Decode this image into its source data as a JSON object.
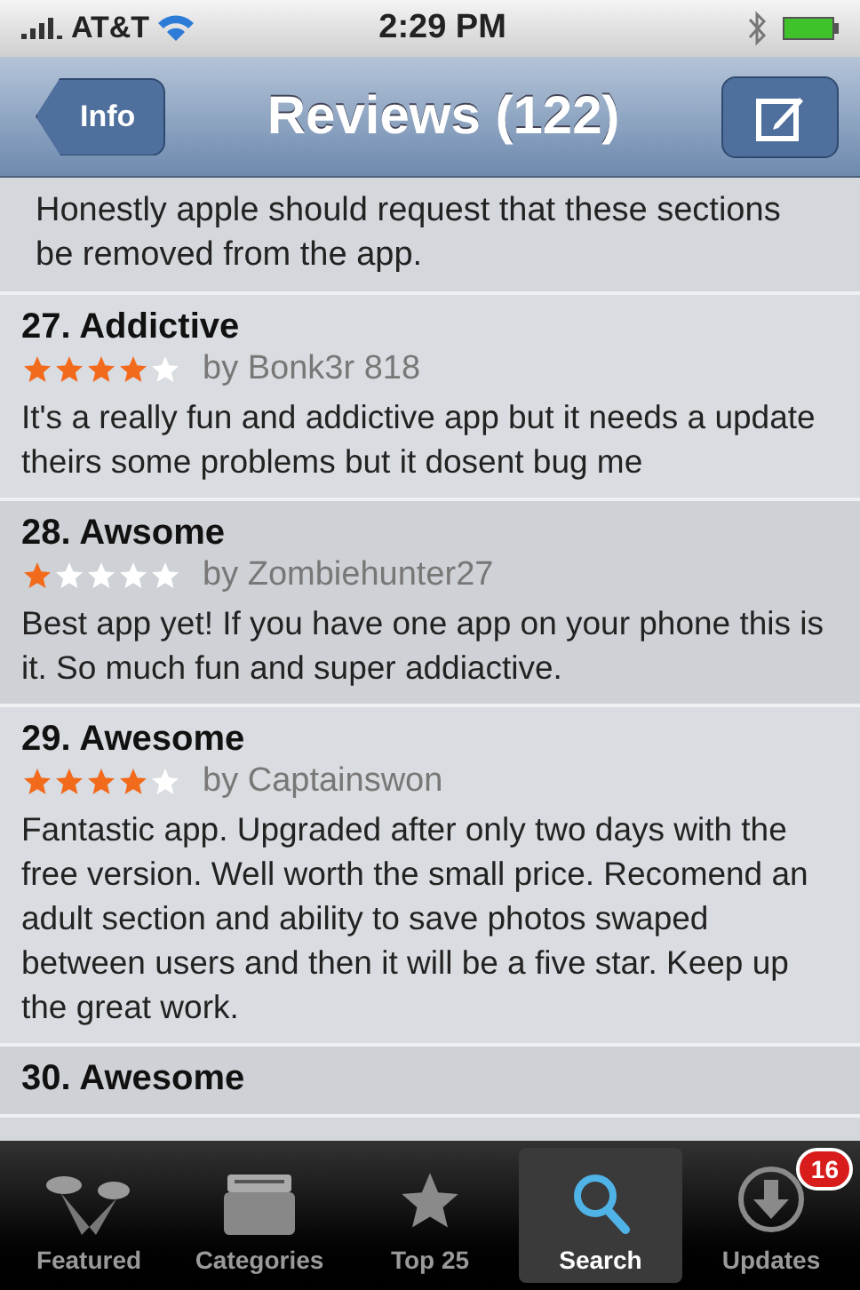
{
  "status_bar": {
    "carrier": "AT&T",
    "time": "2:29 PM"
  },
  "nav": {
    "back": "Info",
    "title": "Reviews (122)"
  },
  "partial_review": {
    "lines": [
      "Honestly apple should request that these sections",
      "be removed from the app."
    ]
  },
  "reviews": [
    {
      "title": "27. Addictive",
      "stars": 4,
      "author": "by Bonk3r 818",
      "body": "It's a really fun and addictive app but it needs a update theirs some problems but it dosent bug me"
    },
    {
      "title": "28. Awsome",
      "stars": 1,
      "author": "by Zombiehunter27",
      "body": "Best app yet! If you have one app on your phone this is it. So much fun and super addiactive."
    },
    {
      "title": "29. Awesome",
      "stars": 4,
      "author": "by Captainswon",
      "body": "Fantastic app. Upgraded after only two days with the free version. Well worth the small price. Recomend an adult section and ability to save photos swaped between users and then it will be a five star. Keep up the great work."
    },
    {
      "title": "30. Awesome"
    }
  ],
  "tabs": [
    {
      "kind": "featured",
      "label": "Featured",
      "selected": false
    },
    {
      "kind": "categories",
      "label": "Categories",
      "selected": false
    },
    {
      "kind": "top",
      "label": "Top 25",
      "selected": false
    },
    {
      "kind": "search",
      "label": "Search",
      "selected": true
    },
    {
      "kind": "updates",
      "label": "Updates",
      "selected": false,
      "badge": "16"
    }
  ]
}
